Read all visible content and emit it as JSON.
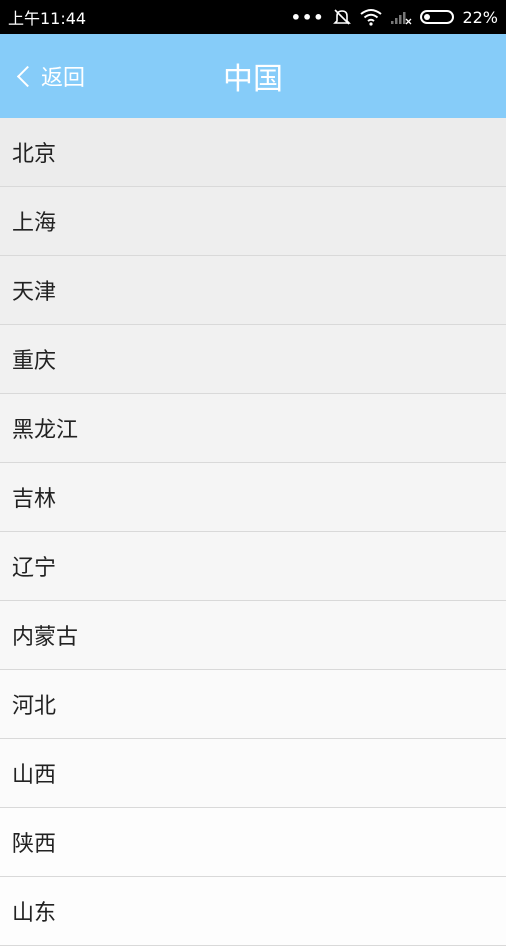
{
  "status_bar": {
    "time": "上午11:44",
    "battery_percent": "22%",
    "battery_level": 0.22,
    "icons": [
      "more-dots-icon",
      "mute-icon",
      "wifi-icon",
      "signal-icon",
      "battery-icon"
    ]
  },
  "header": {
    "back_label": "返回",
    "title": "中国",
    "color": "#86ccf9"
  },
  "regions": [
    {
      "label": "北京"
    },
    {
      "label": "上海"
    },
    {
      "label": "天津"
    },
    {
      "label": "重庆"
    },
    {
      "label": "黑龙江"
    },
    {
      "label": "吉林"
    },
    {
      "label": "辽宁"
    },
    {
      "label": "内蒙古"
    },
    {
      "label": "河北"
    },
    {
      "label": "山西"
    },
    {
      "label": "陕西"
    },
    {
      "label": "山东"
    }
  ]
}
